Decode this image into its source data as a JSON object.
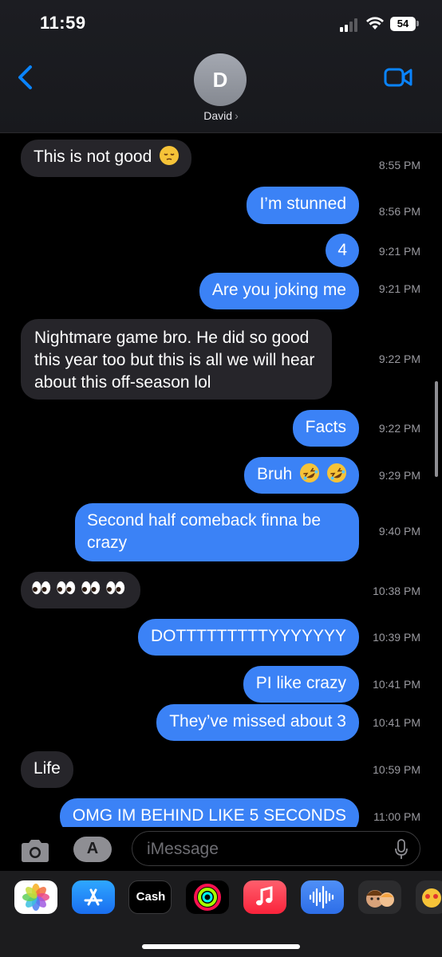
{
  "status_bar": {
    "time": "11:59",
    "battery": "54"
  },
  "contact": {
    "initial": "D",
    "name": "David",
    "chevron": "›"
  },
  "messages": [
    {
      "direction": "in",
      "text": "This is not good",
      "emoji": "pensive-face",
      "time": "8:55 PM"
    },
    {
      "direction": "out",
      "text": "I’m stunned",
      "time": "8:56 PM"
    },
    {
      "direction": "out",
      "text": "4",
      "time": "9:21 PM"
    },
    {
      "direction": "out",
      "text": "Are you joking me",
      "time": "9:21 PM"
    },
    {
      "direction": "in",
      "text": "Nightmare game bro. He did so good this year too but this is all we will hear about this off-season lol",
      "time": "9:22 PM"
    },
    {
      "direction": "out",
      "text": "Facts",
      "time": "9:22 PM"
    },
    {
      "direction": "out",
      "text": "Bruh",
      "emoji": "rolling-on-floor-laughing x2",
      "time": "9:29 PM"
    },
    {
      "direction": "out",
      "text": "Second half comeback finna be crazy",
      "time": "9:40 PM"
    },
    {
      "direction": "in",
      "text": "",
      "emoji": "eyes x4",
      "time": "10:38 PM"
    },
    {
      "direction": "out",
      "text": "DOTTTTTTTTTYYYYYYY",
      "time": "10:39 PM"
    },
    {
      "direction": "out",
      "text": "PI like crazy",
      "time": "10:41 PM"
    },
    {
      "direction": "out",
      "text": "They’ve missed about 3",
      "time": "10:41 PM"
    },
    {
      "direction": "in",
      "text": "Life",
      "time": "10:59 PM"
    },
    {
      "direction": "out",
      "text": "OMG IM BEHIND LIKE 5 SECONDS",
      "time": "11:00 PM"
    }
  ],
  "input": {
    "placeholder": "iMessage"
  },
  "app_drawer": [
    {
      "name": "Photos"
    },
    {
      "name": "App Store"
    },
    {
      "name": "Cash",
      "label": "Cash"
    },
    {
      "name": "Activity"
    },
    {
      "name": "Music"
    },
    {
      "name": "Audio message"
    },
    {
      "name": "Memoji"
    },
    {
      "name": "Memoji stickers"
    }
  ],
  "colors": {
    "blue_bubble": "#3b82f6",
    "gray_bubble": "#26252a",
    "accent": "#0a84ff",
    "background": "#000000"
  }
}
